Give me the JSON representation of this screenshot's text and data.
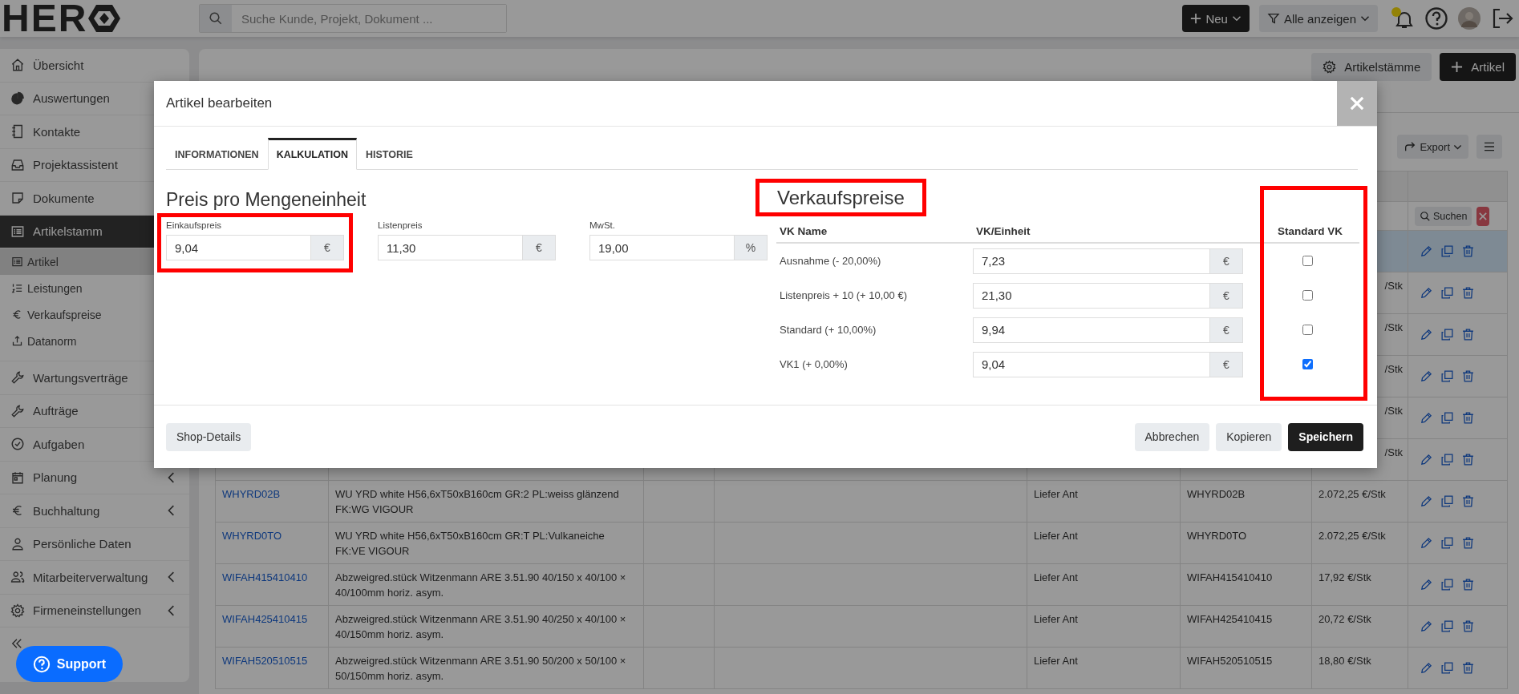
{
  "topbar": {
    "logo": "HER",
    "search": {
      "placeholder": "Suche Kunde, Projekt, Dokument ..."
    },
    "new_button": "Neu",
    "filter_button": "Alle anzeigen",
    "notification_dot": true
  },
  "sidebar": {
    "items": [
      {
        "label": "Übersicht",
        "selected": false
      },
      {
        "label": "Auswertungen",
        "selected": false
      },
      {
        "label": "Kontakte",
        "selected": false
      },
      {
        "label": "Projektassistent",
        "selected": false
      },
      {
        "label": "Dokumente",
        "selected": false
      },
      {
        "label": "Artikelstamm",
        "selected": true,
        "children": [
          {
            "label": "Artikel",
            "selected": true
          },
          {
            "label": "Leistungen",
            "selected": false
          },
          {
            "label": "Verkaufspreise",
            "selected": false
          },
          {
            "label": "Datanorm",
            "selected": false
          }
        ]
      },
      {
        "label": "Wartungsverträge",
        "selected": false
      },
      {
        "label": "Aufträge",
        "selected": false
      },
      {
        "label": "Aufgaben",
        "selected": false
      },
      {
        "label": "Planung",
        "selected": false,
        "expandable": true
      },
      {
        "label": "Buchhaltung",
        "selected": false,
        "expandable": true
      },
      {
        "label": "Persönliche Daten",
        "selected": false
      },
      {
        "label": "Mitarbeiterverwaltung",
        "selected": false,
        "expandable": true
      },
      {
        "label": "Firmeneinstellungen",
        "selected": false,
        "expandable": true
      }
    ],
    "support_button": "Support"
  },
  "page": {
    "actions": [
      {
        "label": "Artikelstämme",
        "kind": "secondary"
      },
      {
        "label": "Artikel",
        "kind": "primary"
      }
    ],
    "export_button": "Export",
    "table": {
      "search_button": "Suchen",
      "rows": [
        {
          "selected": true
        },
        {
          "selected": false,
          "price": "/Stk"
        },
        {
          "selected": false,
          "price": "/Stk"
        },
        {
          "selected": false,
          "price": "/Stk"
        },
        {
          "selected": false,
          "price": "/Stk"
        },
        {
          "selected": false,
          "price": "/Stk"
        },
        {
          "selected": false,
          "article_no": "WHYRD02B",
          "description": "WU YRD white H56,6xT50xB160cm GR:2 PL:weiss glänzend FK:WG VIGOUR",
          "supplier": "Liefer Ant",
          "supplier_no": "WHYRD02B",
          "price": "2.072,25 €/Stk"
        },
        {
          "selected": false,
          "article_no": "WHYRD0TO",
          "description": "WU YRD white H56,6xT50xB160cm GR:T PL:Vulkaneiche FK:VE VIGOUR",
          "supplier": "Liefer Ant",
          "supplier_no": "WHYRD0TO",
          "price": "2.072,25 €/Stk"
        },
        {
          "selected": false,
          "article_no": "WIFAH415410410",
          "description": "Abzweigred.stück Witzenmann ARE 3.51.90 40/150 x 40/100 × 40/100mm horiz. asym.",
          "supplier": "Liefer Ant",
          "supplier_no": "WIFAH415410410",
          "price": "17,92 €/Stk"
        },
        {
          "selected": false,
          "article_no": "WIFAH425410415",
          "description": "Abzweigred.stück Witzenmann ARE 3.51.90 40/250 x 40/100 × 40/150mm horiz. asym.",
          "supplier": "Liefer Ant",
          "supplier_no": "WIFAH425410415",
          "price": "20,72 €/Stk"
        },
        {
          "selected": false,
          "article_no": "WIFAH520510515",
          "description": "Abzweigred.stück Witzenmann ARE 3.51.90 50/200 x 50/100 × 50/150mm horiz. asym.",
          "supplier": "Liefer Ant",
          "supplier_no": "WIFAH520510515",
          "price": "18,80 €/Stk"
        }
      ]
    }
  },
  "modal": {
    "title": "Artikel bearbeiten",
    "tabs": [
      {
        "label": "INFORMATIONEN",
        "selected": false
      },
      {
        "label": "KALKULATION",
        "selected": true
      },
      {
        "label": "HISTORIE",
        "selected": false
      }
    ],
    "price_section": {
      "heading": "Preis pro Mengeneinheit",
      "fields": [
        {
          "label": "Einkaufspreis",
          "value": "9,04",
          "unit": "€",
          "highlighted": true
        },
        {
          "label": "Listenpreis",
          "value": "11,30",
          "unit": "€",
          "highlighted": false
        },
        {
          "label": "MwSt.",
          "value": "19,00",
          "unit": "%",
          "highlighted": false
        }
      ]
    },
    "sales_section": {
      "heading": "Verkaufspreise",
      "heading_highlighted": true,
      "columns": [
        "VK Name",
        "VK/Einheit",
        "Standard VK"
      ],
      "standard_column_highlighted": true,
      "rows": [
        {
          "name": "Ausnahme (- 20,00%)",
          "value": "7,23",
          "unit": "€",
          "checked": false
        },
        {
          "name": "Listenpreis + 10 (+ 10,00 €)",
          "value": "21,30",
          "unit": "€",
          "checked": false
        },
        {
          "name": "Standard (+ 10,00%)",
          "value": "9,94",
          "unit": "€",
          "checked": false
        },
        {
          "name": "VK1 (+ 0,00%)",
          "value": "9,04",
          "unit": "€",
          "checked": true
        }
      ]
    },
    "footer": {
      "left_button": "Shop-Details",
      "buttons": [
        {
          "label": "Abbrechen",
          "kind": "secondary"
        },
        {
          "label": "Kopieren",
          "kind": "secondary"
        },
        {
          "label": "Speichern",
          "kind": "primary"
        }
      ]
    }
  }
}
